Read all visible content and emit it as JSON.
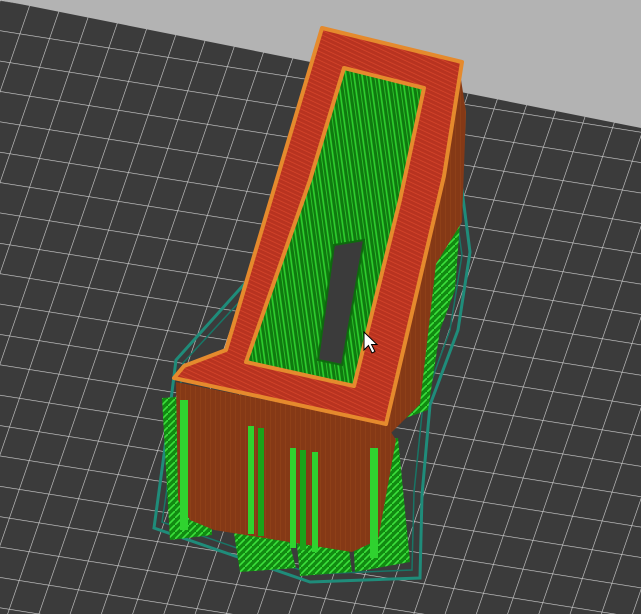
{
  "viewport": {
    "kind": "slicer-3d-preview",
    "colors": {
      "background": "#b3b3b3",
      "bed": "#3b3b3b",
      "bed_grid": "#cfcfcf",
      "perimeter": "#e58a2d",
      "wall": "#8a3a17",
      "top_solid": "#c2371f",
      "infill": "#16a416",
      "support": "#2cc02c",
      "skirt": "#1f8c7a"
    },
    "icons": [
      "mouse-pointer-icon"
    ]
  }
}
